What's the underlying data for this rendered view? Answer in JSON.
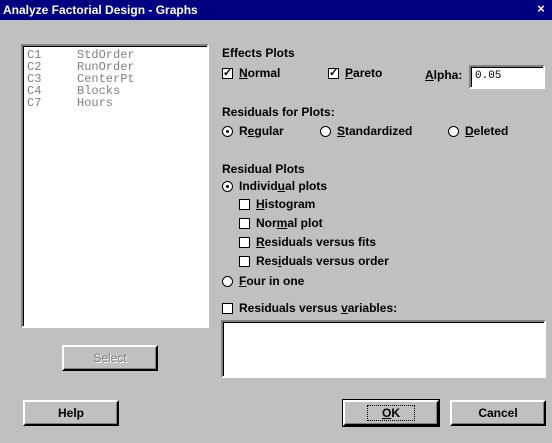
{
  "window": {
    "title": "Analyze Factorial Design - Graphs",
    "close_glyph": "×"
  },
  "variables": [
    {
      "col": "C1",
      "name": "StdOrder"
    },
    {
      "col": "C2",
      "name": "RunOrder"
    },
    {
      "col": "C3",
      "name": "CenterPt"
    },
    {
      "col": "C4",
      "name": "Blocks"
    },
    {
      "col": "C7",
      "name": "Hours"
    }
  ],
  "select_button": "Select",
  "effects": {
    "heading": "Effects Plots",
    "normal_label": "Normal",
    "pareto_label": "Pareto",
    "alpha_label": "Alpha:",
    "alpha_value": "0.05",
    "normal_checked": true,
    "pareto_checked": true
  },
  "residuals_for_plots": {
    "heading": "Residuals for Plots:",
    "options": [
      "Regular",
      "Standardized",
      "Deleted"
    ],
    "selected": "Regular"
  },
  "residual_plots": {
    "heading": "Residual Plots",
    "individual_label": "Individual plots",
    "individual_selected": true,
    "histogram_label": "Histogram",
    "normal_plot_label": "Normal plot",
    "vs_fits_label": "Residuals versus fits",
    "vs_order_label": "Residuals versus order",
    "four_in_one_label": "Four in one",
    "vs_variables_label": "Residuals versus variables:"
  },
  "buttons": {
    "help": "Help",
    "ok": "OK",
    "cancel": "Cancel"
  }
}
